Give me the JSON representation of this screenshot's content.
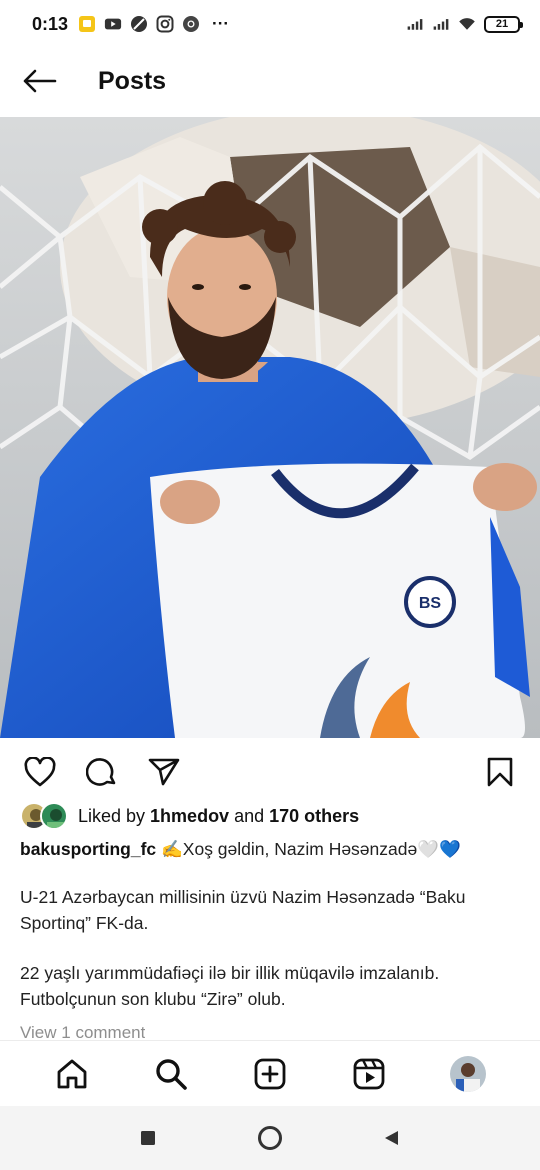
{
  "status_bar": {
    "time": "0:13",
    "more": "···",
    "battery": "21",
    "icons": [
      "notification-icon",
      "youtube-icon",
      "no-disturb-icon",
      "instagram-icon",
      "chrome-icon",
      "signal-icon",
      "signal-icon",
      "wifi-icon",
      "battery-icon"
    ]
  },
  "header": {
    "title": "Posts",
    "back_icon": "arrow-left-icon"
  },
  "post": {
    "image_desc_icon": "post-photo",
    "actions": [
      "heart-icon",
      "comment-icon",
      "share-icon",
      "bookmark-icon"
    ],
    "likes": {
      "prefix": "Liked by ",
      "user": "1hmedov",
      "middle": " and ",
      "others": "170 others"
    },
    "caption": {
      "username": "bakusporting_fc",
      "first_line": " ✍️Xoş gəldin, Nazim Həsənzadə🤍💙",
      "paragraph_1": "U-21 Azərbaycan millisinin üzvü Nazim Həsənzadə “Baku Sportinq” FK-da.",
      "paragraph_2": "22 yaşlı yarımmüdafiəçi ilə bir illik müqavilə imzalanıb. Futbolçunun son klubu “Zirə” olub."
    },
    "view_comments": "View 1 comment"
  },
  "bottom_nav": {
    "items": [
      "home-icon",
      "search-icon",
      "create-icon",
      "reels-icon",
      "profile-avatar"
    ]
  },
  "system_nav": {
    "items": [
      "recents-icon",
      "home-circle-icon",
      "back-triangle-icon"
    ]
  },
  "colors": {
    "text": "#111111",
    "muted": "#8e8e8e",
    "jersey_blue": "#1e5bd6",
    "heart_blue": "#3b8be8"
  }
}
